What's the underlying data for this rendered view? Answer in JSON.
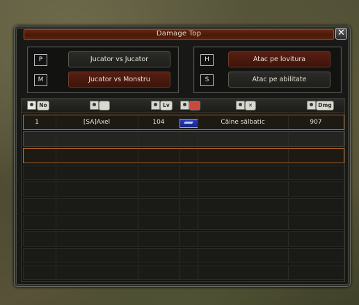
{
  "window": {
    "title": "Damage Top",
    "close_glyph": "✕"
  },
  "modes": {
    "pvp": {
      "key": "P",
      "label": "Jucator vs Jucator"
    },
    "pvm": {
      "key": "M",
      "label": "Jucator vs Monstru"
    },
    "hit": {
      "key": "H",
      "label": "Atac pe lovitura"
    },
    "skill": {
      "key": "S",
      "label": "Atac pe abilitate"
    }
  },
  "columns": {
    "rank": {
      "label": "No"
    },
    "name": {
      "icon": "character-icon"
    },
    "level": {
      "label": "Lv"
    },
    "empire": {
      "icon": "empire-flag-icon"
    },
    "target": {
      "icon": "target-icon"
    },
    "damage": {
      "label": "Dmg"
    }
  },
  "rows": [
    {
      "rank": "1",
      "name": "[SA]Axel",
      "level": "104",
      "empire_color": "#2a3cc4",
      "target": "Câine sălbatic",
      "damage": "907"
    }
  ],
  "colors": {
    "title_bar": "#5b230e",
    "selected_button": "#5a1f12",
    "row_highlight": "#c4692a"
  }
}
